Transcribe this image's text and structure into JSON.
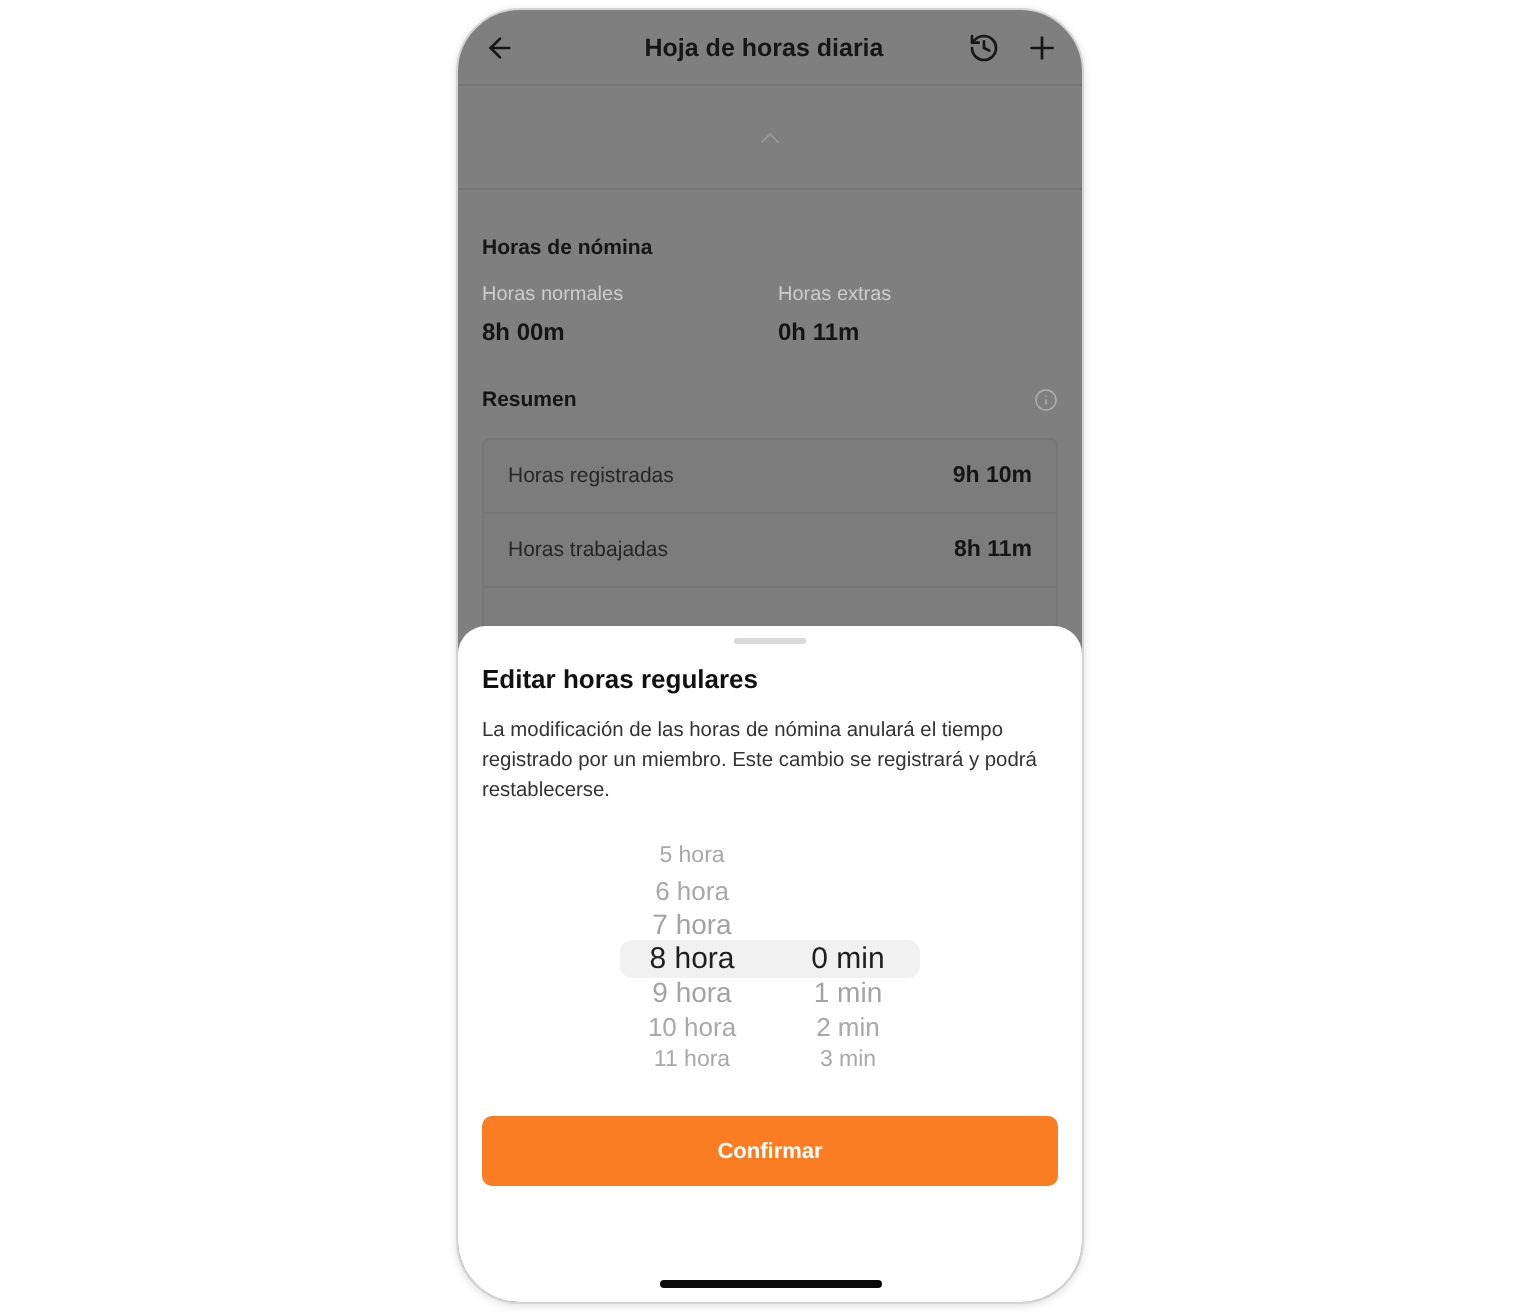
{
  "header": {
    "title": "Hoja de horas diaria"
  },
  "payroll": {
    "title": "Horas de nómina",
    "items": [
      {
        "label": "Horas normales",
        "value": "8h 00m"
      },
      {
        "label": "Horas extras",
        "value": "0h 11m"
      }
    ]
  },
  "summary": {
    "title": "Resumen",
    "rows": [
      {
        "label": "Horas registradas",
        "value": "9h 10m"
      },
      {
        "label": "Horas trabajadas",
        "value": "8h 11m"
      }
    ]
  },
  "sheet": {
    "title": "Editar horas regulares",
    "description": "La modificación de las horas de nómina anulará el tiempo registrado por un miembro. Este cambio se registrará y podrá restablecerse.",
    "picker": {
      "hours": [
        {
          "label": "5 hora",
          "selected": false
        },
        {
          "label": "6 hora",
          "selected": false
        },
        {
          "label": "7 hora",
          "selected": false
        },
        {
          "label": "8 hora",
          "selected": true
        },
        {
          "label": "9 hora",
          "selected": false
        },
        {
          "label": "10 hora",
          "selected": false
        },
        {
          "label": "11 hora",
          "selected": false
        }
      ],
      "minutes": [
        {
          "label": "0 min",
          "selected": true
        },
        {
          "label": "1 min",
          "selected": false
        },
        {
          "label": "2 min",
          "selected": false
        },
        {
          "label": "3 min",
          "selected": false
        }
      ]
    },
    "confirm_button": "Confirmar"
  }
}
